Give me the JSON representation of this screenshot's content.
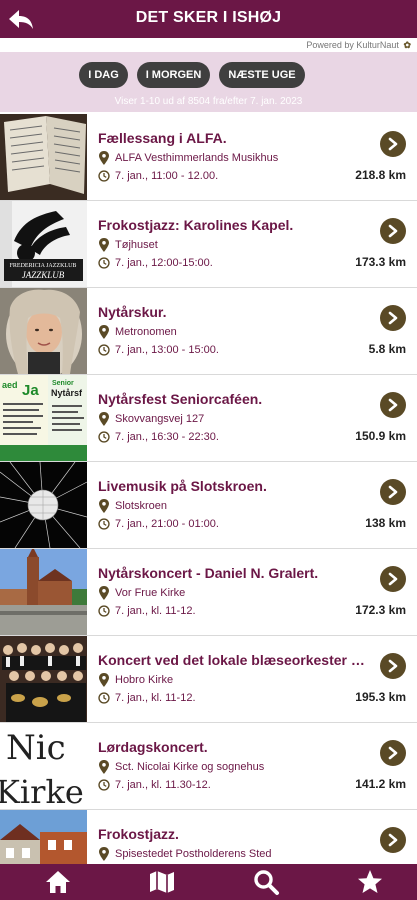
{
  "header": {
    "title": "DET SKER I ISHØJ",
    "back_icon": "back-arrow-icon"
  },
  "powered_by": {
    "text": "Powered by KulturNaut"
  },
  "filters": {
    "today": "I DAG",
    "tomorrow": "I MORGEN",
    "next_week": "NÆSTE UGE",
    "shown_text": "Viser 1-10 ud af 8504 fra/efter 7. jan. 2023"
  },
  "events": [
    {
      "title": "Fællessang i ALFA.",
      "location": "ALFA Vesthimmerlands Musikhus",
      "time": "7. jan., 11:00 - 12.00.",
      "distance": "218.8 km"
    },
    {
      "title": "Frokostjazz: Karolines Kapel.",
      "location": "Tøjhuset",
      "time": "7. jan., 12:00-15:00.",
      "distance": "173.3 km"
    },
    {
      "title": "Nytårskur.",
      "location": "Metronomen",
      "time": "7. jan., 13:00 - 15:00.",
      "distance": "5.8 km"
    },
    {
      "title": "Nytårsfest Seniorcaféen.",
      "location": "Skovvangsvej 127",
      "time": "7. jan., 16:30 - 22:30.",
      "distance": "150.9 km"
    },
    {
      "title": "Livemusik på Slotskroen.",
      "location": "Slotskroen",
      "time": "7. jan., 21:00 - 01:00.",
      "distance": "138 km"
    },
    {
      "title": "Nytårskoncert - Daniel N. Gralert.",
      "location": "Vor Frue Kirke",
      "time": "7. jan., kl. 11-12.",
      "distance": "172.3 km"
    },
    {
      "title": "Koncert ved det lokale blæseorkester P...",
      "location": "Hobro Kirke",
      "time": "7. jan., kl. 11-12.",
      "distance": "195.3 km"
    },
    {
      "title": "Lørdagskoncert.",
      "location": "Sct. Nicolai Kirke og sognehus",
      "time": "7. jan., kl. 11.30-12.",
      "distance": "141.2 km"
    },
    {
      "title": "Frokostjazz.",
      "location": "Spisestedet Postholderens Sted",
      "time": "",
      "distance": ""
    }
  ],
  "thumb_text": {
    "jazzklub": "FREDERICIA JAZZKLUB",
    "flyer_big": "Ja",
    "flyer_senior": "Senior",
    "flyer_nytaar": "Nytårsf",
    "nicolai_top": "Nic",
    "nicolai_bottom": "Kirke"
  },
  "colors": {
    "brand": "#6b1746",
    "filter_bg": "#e9d6e4",
    "chip": "#3f3f3f",
    "arrow": "#5a4a26"
  },
  "bottom_nav": {
    "items": [
      "home-icon",
      "map-icon",
      "search-icon",
      "star-icon"
    ]
  }
}
